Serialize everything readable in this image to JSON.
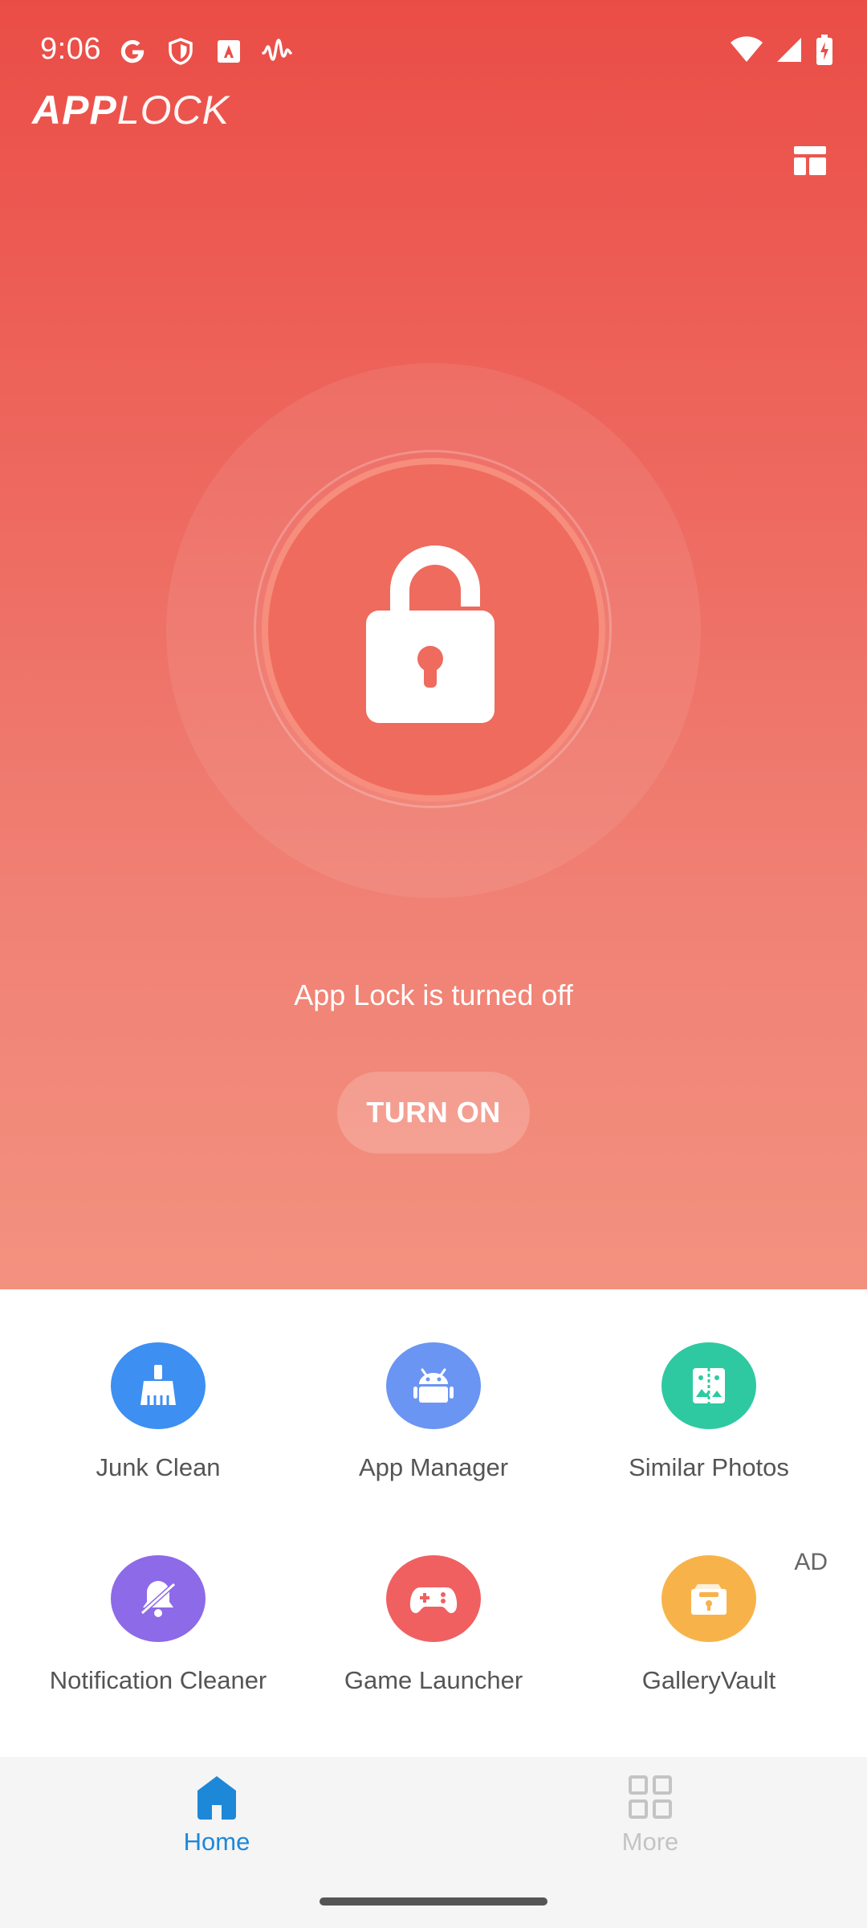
{
  "status_bar": {
    "time": "9:06",
    "left_icons": [
      "google-icon",
      "shield-icon",
      "adobe-icon",
      "waveform-icon"
    ],
    "right_icons": [
      "wifi-icon",
      "signal-icon",
      "battery-charging-icon"
    ]
  },
  "app_bar": {
    "title_bold": "APP",
    "title_thin": "LOCK",
    "action_icon": "layout-icon"
  },
  "lock_panel": {
    "icon": "unlocked-padlock-icon",
    "status_text": "App Lock is turned off",
    "button_label": "TURN ON"
  },
  "tools": [
    {
      "label": "Junk Clean",
      "icon": "broom-icon",
      "color": "#3d8ff2"
    },
    {
      "label": "App Manager",
      "icon": "android-icon",
      "color": "#6b95f2"
    },
    {
      "label": "Similar Photos",
      "icon": "similar-photos-icon",
      "color": "#2ec9a0"
    },
    {
      "label": "Notification Cleaner",
      "icon": "bell-off-icon",
      "color": "#8d6ae8"
    },
    {
      "label": "Game Launcher",
      "icon": "gamepad-icon",
      "color": "#f06061"
    },
    {
      "label": "GalleryVault",
      "icon": "vault-icon",
      "color": "#f7b34a",
      "badge": "AD"
    }
  ],
  "bottom_nav": {
    "items": [
      {
        "label": "Home",
        "icon": "home-icon",
        "active": true,
        "color": "#1e88d8"
      },
      {
        "label": "More",
        "icon": "grid-icon",
        "active": false,
        "color": "#c4c4c4"
      }
    ]
  },
  "colors": {
    "hero_top": "#ea4d46",
    "hero_bottom": "#f3917f",
    "accent": "#1e88d8"
  }
}
